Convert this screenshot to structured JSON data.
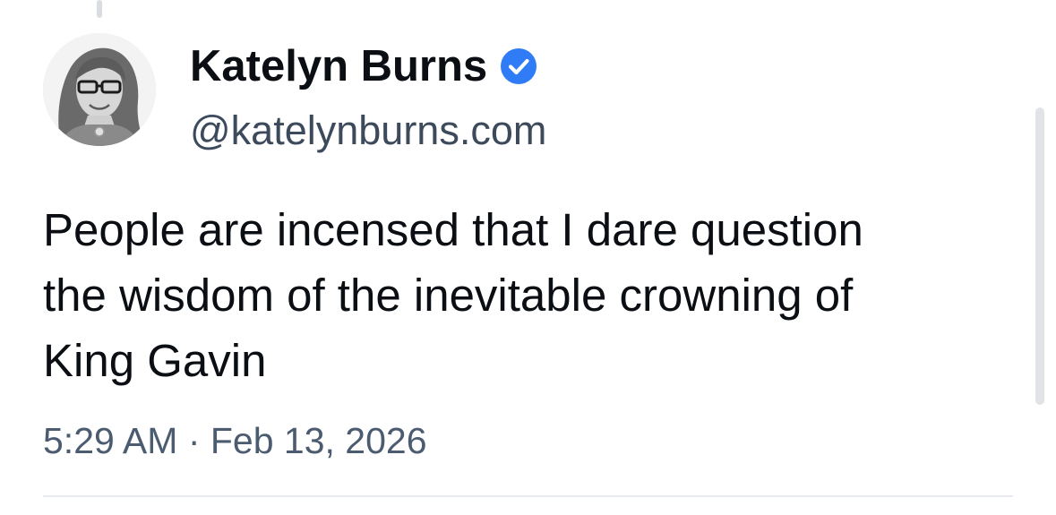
{
  "post": {
    "author": {
      "name": "Katelyn Burns",
      "handle": "@katelynburns.com",
      "verified": true,
      "avatar_icon": "avatar-portrait-icon",
      "verified_icon": "verified-badge-icon"
    },
    "text_lines": [
      "People are incensed that I dare question",
      "the wisdom of the inevitable crowning of",
      "King Gavin"
    ],
    "timestamp": "5:29 AM · Feb 13, 2026"
  },
  "colors": {
    "verified_blue": "#2f7cf6",
    "name_text": "#0b0f14",
    "secondary_text": "#4b5b70"
  }
}
